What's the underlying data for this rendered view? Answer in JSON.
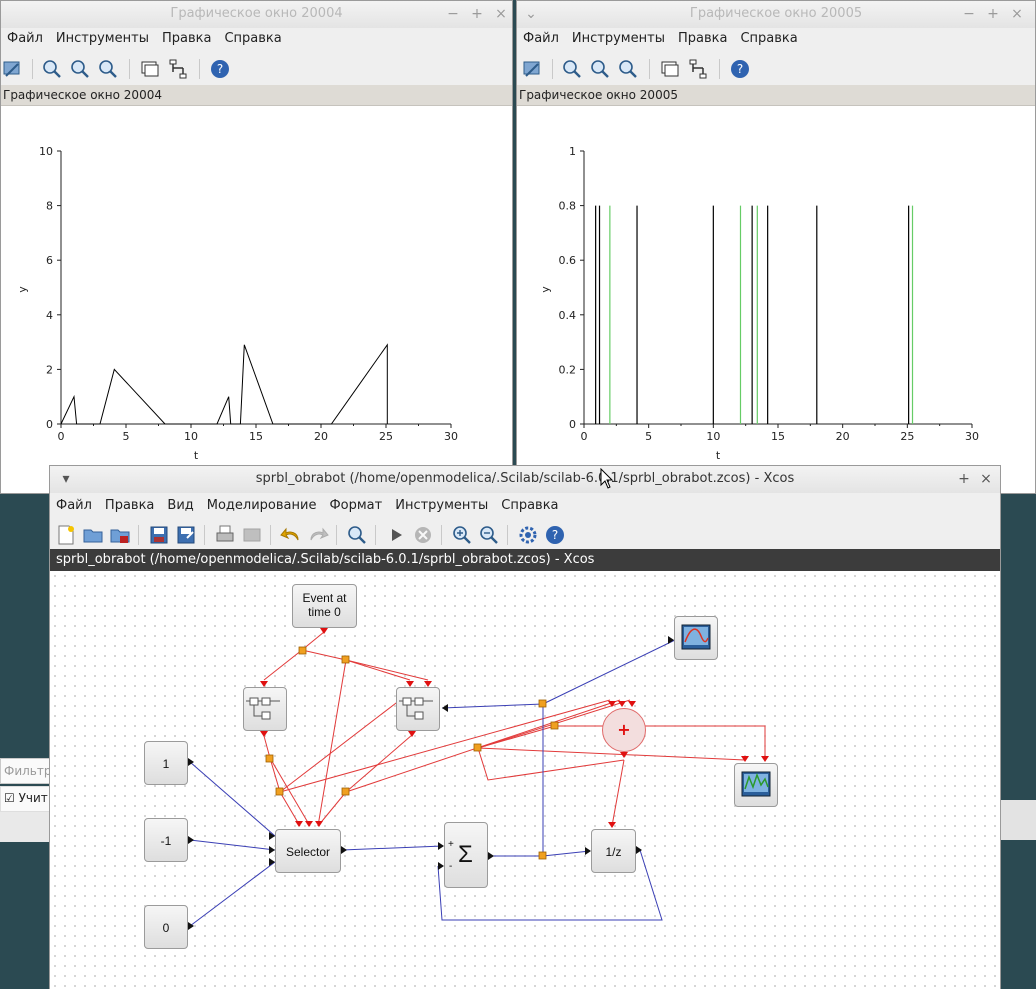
{
  "window1": {
    "title": "Графическое окно 20004",
    "menu": [
      "Файл",
      "Инструменты",
      "Правка",
      "Справка"
    ],
    "subtitle": "Графическое окно 20004"
  },
  "window2": {
    "title": "Графическое окно 20005",
    "menu": [
      "Файл",
      "Инструменты",
      "Правка",
      "Справка"
    ],
    "subtitle": "Графическое окно 20005"
  },
  "background_stub": {
    "filter_placeholder": "Фильтр",
    "checkbox_label": "Учит"
  },
  "xcos": {
    "title": "sprbl_obrabot (/home/openmodelica/.Scilab/scilab-6.0.1/sprbl_obrabot.zcos) - Xcos",
    "path_bar": "sprbl_obrabot (/home/openmodelica/.Scilab/scilab-6.0.1/sprbl_obrabot.zcos) - Xcos",
    "menu": [
      "Файл",
      "Правка",
      "Вид",
      "Моделирование",
      "Формат",
      "Инструменты",
      "Справка"
    ],
    "blocks": {
      "event_line1": "Event at",
      "event_line2": "time 0",
      "const1": "1",
      "const_neg1": "-1",
      "const0": "0",
      "selector": "Selector",
      "sum_symbol": "Σ",
      "sum_plus": "+",
      "sum_minus": "-",
      "delay": "1/z",
      "adder": "+"
    }
  },
  "chart_data": [
    {
      "type": "line",
      "xlabel": "t",
      "ylabel": "y",
      "xlim": [
        0,
        30
      ],
      "ylim": [
        0,
        10
      ],
      "xticks": [
        0,
        5,
        10,
        15,
        20,
        25,
        30
      ],
      "yticks": [
        0,
        2,
        4,
        6,
        8,
        10
      ],
      "color": "#000000",
      "x": [
        0,
        1,
        1.2,
        3,
        4.1,
        8,
        12,
        12.9,
        13.05,
        13.8,
        14.1,
        16.3,
        16.5,
        20.8,
        25.1,
        25.1
      ],
      "y": [
        0,
        1,
        0,
        0,
        2,
        0,
        0,
        1,
        0,
        0,
        2.9,
        0,
        0,
        0,
        2.9,
        0
      ]
    },
    {
      "type": "line",
      "xlabel": "t",
      "ylabel": "y",
      "xlim": [
        0,
        30
      ],
      "ylim": [
        0,
        1
      ],
      "xticks": [
        0,
        5,
        10,
        15,
        20,
        25,
        30
      ],
      "yticks": [
        0,
        0.2,
        0.4,
        0.6,
        0.8,
        1
      ],
      "series": [
        {
          "color": "#000000",
          "impulses_x": [
            0.9,
            1.2,
            4.1,
            10,
            13,
            14.2,
            18,
            25.1
          ],
          "height": 0.8
        },
        {
          "color": "#66cc66",
          "impulses_x": [
            2,
            12.1,
            13.4,
            25.4
          ],
          "height": 0.8
        }
      ]
    }
  ]
}
